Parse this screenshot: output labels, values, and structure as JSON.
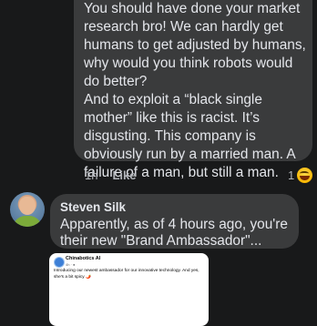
{
  "comment1": {
    "paragraph1": "You should have done your market research bro! We can hardly get humans to get adjusted by humans, why would you think robots would do better?",
    "paragraph2": "And to exploit a “black single mother” like this is racist. It’s disgusting. This company is obviously run by a married man. A failure of a man, but still a man.",
    "time": "1h",
    "like_label": "Like",
    "reaction_count": "1",
    "reaction_icon": "haha-emoji-icon"
  },
  "comment2": {
    "author": "Steven Silk",
    "text": "Apparently, as of 4 hours ago, you're their new \"Brand Ambassador\"...",
    "preview": {
      "page_name": "Chinabotics AI",
      "subtitle": "4h · ●",
      "text": "Introducing our newest ambassador for our innovative technology. And yes, she's a bit spicy 🌶️"
    }
  },
  "colors": {
    "background": "#18191a",
    "bubble": "#3a3b3c",
    "text": "#e4e6eb",
    "secondary_text": "#b0b3b8"
  }
}
